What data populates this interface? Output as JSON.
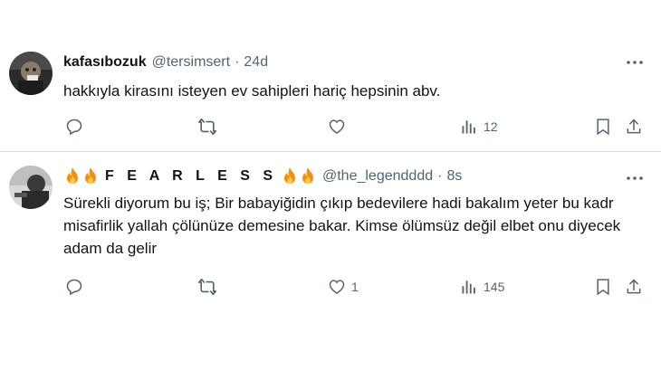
{
  "tweets": [
    {
      "display_name": "kafasıbozuk",
      "handle": "@tersimsert",
      "separator": "·",
      "time": "24d",
      "text": "hakkıyla kirasını isteyen ev sahipleri hariç hepsinin abv.",
      "views": "12",
      "likes": ""
    },
    {
      "display_name": "F E A R L E S S",
      "handle": "@the_legendddd",
      "separator": "·",
      "time": "8s",
      "text": "Sürekli diyorum bu iş; Bir babayiğidin çıkıp bedevilere hadi bakalım yeter bu kadr misafirlik yallah çölünüze demesine bakar. Kimse ölümsüz değil elbet onu diyecek adam da gelir",
      "views": "145",
      "likes": "1"
    }
  ],
  "icons": {
    "reply": "reply-icon",
    "retweet": "retweet-icon",
    "like": "heart-icon",
    "views": "views-icon",
    "bookmark": "bookmark-icon",
    "share": "share-icon",
    "more": "more-icon",
    "emoji": "fire-emoji"
  },
  "colors": {
    "text": "#0f1419",
    "secondary": "#536471",
    "divider": "#d8dde1"
  }
}
